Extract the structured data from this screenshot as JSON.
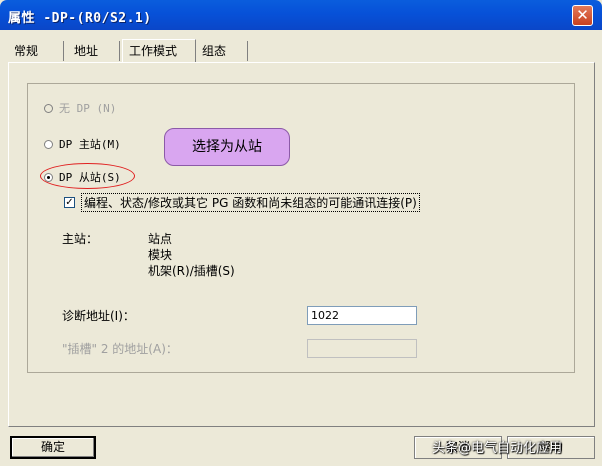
{
  "window": {
    "title": "属性 -DP-(R0/S2.1)",
    "close_glyph": "✕"
  },
  "tabs": [
    {
      "label": "常规"
    },
    {
      "label": "地址"
    },
    {
      "label": "工作模式"
    },
    {
      "label": "组态"
    }
  ],
  "active_tab": "工作模式",
  "mode": {
    "options": [
      {
        "label": "无 DP (N)",
        "selected": false,
        "enabled": false
      },
      {
        "label": "DP 主站(M)",
        "selected": false,
        "enabled": true
      },
      {
        "label": "DP 从站(S)",
        "selected": true,
        "enabled": true
      }
    ]
  },
  "annotation": {
    "callout_text": "选择为从站",
    "ellipse_color": "#e02020",
    "callout_color": "#d9a6f0"
  },
  "programming": {
    "checked": true,
    "check_glyph": "✓",
    "label": "编程、状态/修改或其它 PG 函数和尚未组态的可能通讯连接(P)"
  },
  "master": {
    "label": "主站：",
    "items": [
      "站点",
      "模块",
      "机架(R)/插槽(S)"
    ]
  },
  "diagnostic_address": {
    "label": "诊断地址(I)：",
    "value": "1022"
  },
  "slot2_address": {
    "label": "\"插槽\" 2 的地址(A)：",
    "value": "",
    "enabled": false
  },
  "buttons": {
    "ok": "确定",
    "cancel": "取消",
    "help": "帮助"
  },
  "watermark": "头条@电气自动化应用"
}
